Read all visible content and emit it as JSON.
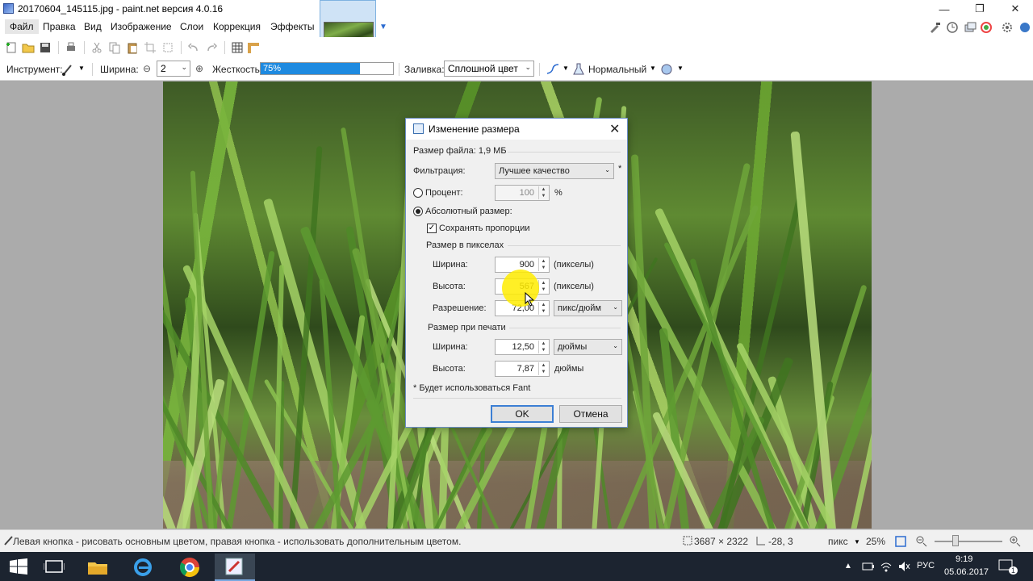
{
  "window": {
    "title": "20170604_145115.jpg - paint.net версия 4.0.16",
    "min": "—",
    "restore": "❐",
    "close": "✕"
  },
  "menu": {
    "items": [
      "Файл",
      "Правка",
      "Вид",
      "Изображение",
      "Слои",
      "Коррекция",
      "Эффекты"
    ]
  },
  "toolbar": {
    "tool_label": "Инструмент:",
    "width_label": "Ширина:",
    "width_value": "2",
    "hardness_label": "Жесткость:",
    "hardness_value": "75%",
    "hardness_fraction": 0.75,
    "fill_label": "Заливка:",
    "fill_value": "Сплошной цвет",
    "blend_value": "Нормальный"
  },
  "dialog": {
    "title": "Изменение размера",
    "file_size": "Размер файла: 1,9 МБ",
    "filter_label": "Фильтрация:",
    "filter_value": "Лучшее качество",
    "asterisk": "*",
    "percent_label": "Процент:",
    "percent_value": "100",
    "percent_unit": "%",
    "absolute_label": "Абсолютный размер:",
    "keep_ratio_label": "Сохранять пропорции",
    "pixel_size_heading": "Размер в пикселах",
    "width_label": "Ширина:",
    "width_value": "900",
    "width_unit": "(пикселы)",
    "height_label": "Высота:",
    "height_value": "567",
    "height_unit": "(пикселы)",
    "resolution_label": "Разрешение:",
    "resolution_value": "72,00",
    "resolution_unit": "пикс/дюйм",
    "print_size_heading": "Размер при печати",
    "print_width_label": "Ширина:",
    "print_width_value": "12,50",
    "print_width_unit": "дюймы",
    "print_height_label": "Высота:",
    "print_height_value": "7,87",
    "print_height_unit": "дюймы",
    "note": "* Будет использоваться Fant",
    "ok": "OK",
    "cancel": "Отмена"
  },
  "status": {
    "hint": "Левая кнопка - рисовать основным цветом, правая кнопка - использовать дополнительным цветом.",
    "image_size": "3687 × 2322",
    "cursor_pos": "-28, 3",
    "units": "пикс",
    "zoom": "25%"
  },
  "taskbar": {
    "language": "РУС",
    "time": "9:19",
    "date": "05.06.2017",
    "notifications": "1"
  },
  "colors": {
    "accent": "#1e8ae0",
    "taskbar": "#1c2430",
    "dialog_border": "#6a8cc6"
  }
}
